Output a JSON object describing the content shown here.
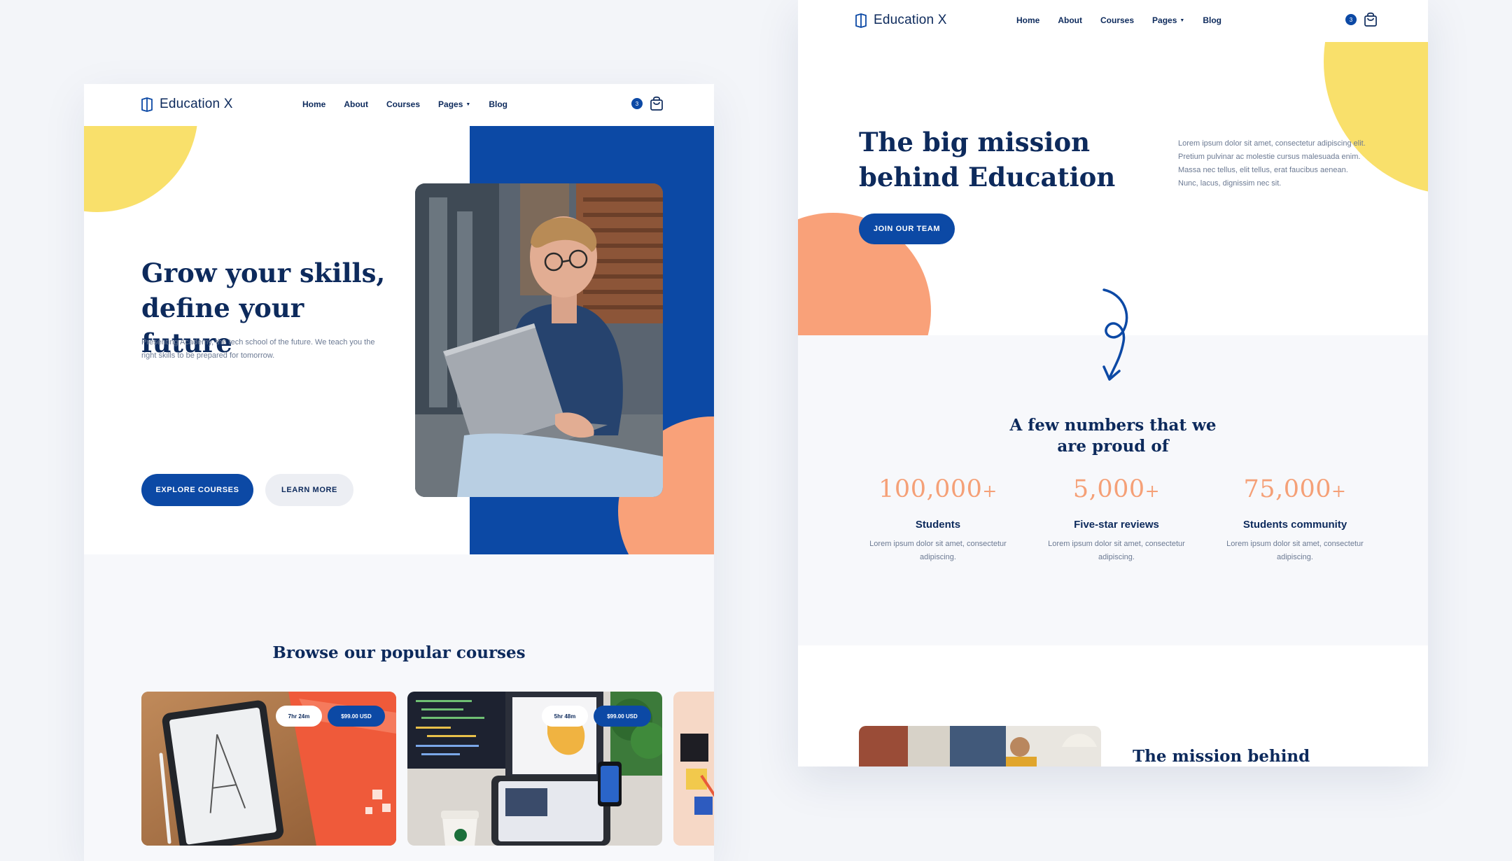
{
  "brand": {
    "name": "Education X"
  },
  "nav": {
    "items": [
      "Home",
      "About",
      "Courses",
      "Pages",
      "Blog"
    ],
    "cart_count": "3"
  },
  "icons": {
    "logo": "book-icon",
    "cart": "shopping-bag-icon",
    "dropdown": "chevron-down-icon"
  },
  "colors": {
    "primary": "#0c49a5",
    "navy": "#0d2a5c",
    "yellow": "#f9e06b",
    "orange": "#f9a179",
    "background": "#f3f5f9"
  },
  "left_page": {
    "hero": {
      "title": "Grow your skills, define your future",
      "text": "Presenting Academy, the tech school of the future. We teach you the right skills to be prepared for tomorrow.",
      "primary_button": "EXPLORE COURSES",
      "secondary_button": "LEARN MORE"
    },
    "courses": {
      "title": "Browse our popular courses",
      "cards": [
        {
          "duration": "7hr 24m",
          "price": "$99.00 USD"
        },
        {
          "duration": "5hr 48m",
          "price": "$99.00 USD"
        }
      ]
    }
  },
  "right_page": {
    "mission": {
      "title": "The big mission behind Education",
      "text": "Lorem ipsum dolor sit amet, consectetur adipiscing elit. Pretium pulvinar ac molestie cursus malesuada enim. Massa nec tellus, elit tellus, erat faucibus aenean. Nunc, lacus, dignissim nec sit.",
      "button": "JOIN OUR TEAM"
    },
    "stats": {
      "title": "A few numbers that we are proud of",
      "items": [
        {
          "value": "100,000",
          "suffix": "+",
          "label": "Students",
          "desc": "Lorem ipsum dolor sit amet, consectetur adipiscing."
        },
        {
          "value": "5,000",
          "suffix": "+",
          "label": "Five-star reviews",
          "desc": "Lorem ipsum dolor sit amet, consectetur adipiscing."
        },
        {
          "value": "75,000",
          "suffix": "+",
          "label": "Students community",
          "desc": "Lorem ipsum dolor sit amet, consectetur adipiscing."
        }
      ]
    },
    "bottom": {
      "title": "The mission behind"
    }
  }
}
